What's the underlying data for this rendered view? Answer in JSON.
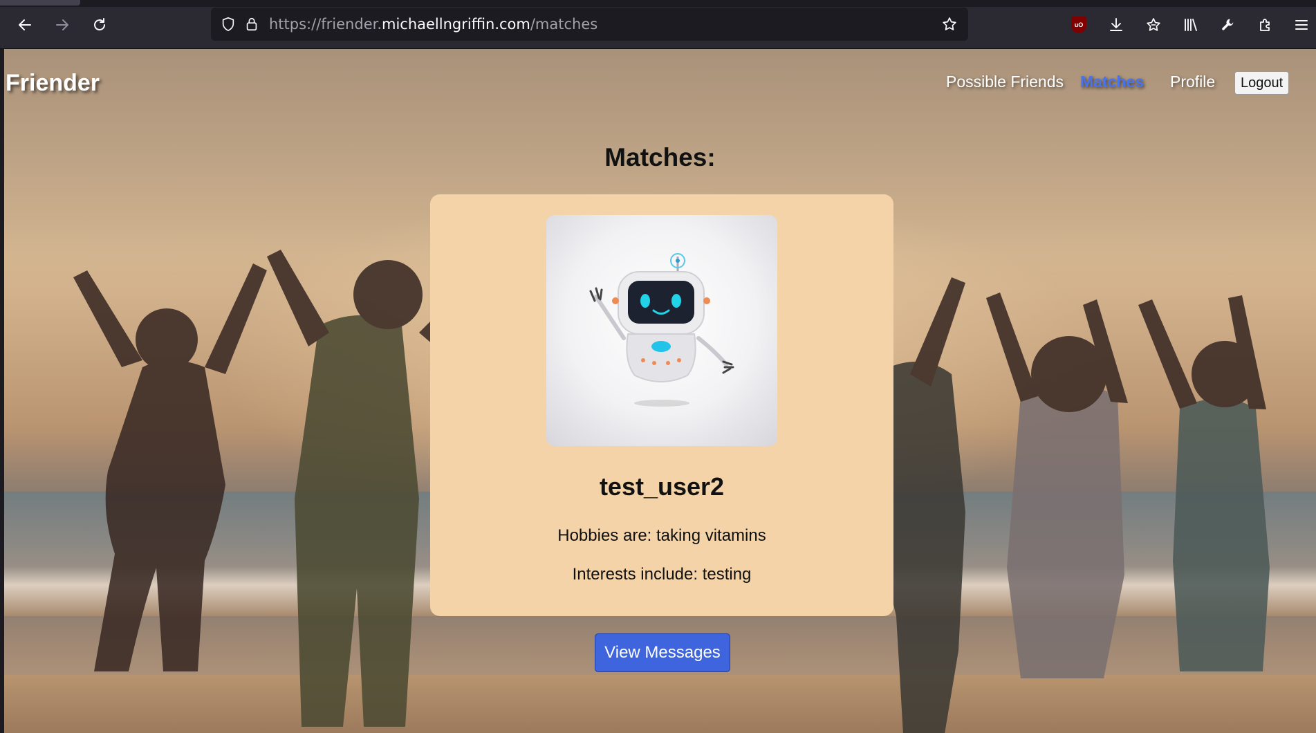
{
  "browser": {
    "url_prefix": "https://friender.",
    "url_domain": "michaellngriffin.com",
    "url_path": "/matches",
    "ublock_badge": "uO"
  },
  "nav": {
    "brand": "Friender",
    "links": [
      "Possible Friends",
      "Matches",
      "Profile"
    ],
    "active_link": "Matches",
    "logout": "Logout"
  },
  "page": {
    "heading": "Matches:",
    "match": {
      "username": "test_user2",
      "hobbies": "Hobbies are: taking vitamins",
      "interests": "Interests include: testing"
    },
    "view_messages": "View Messages"
  },
  "colors": {
    "card": "#f3d3a7",
    "accent": "#3e64de",
    "active_link": "#4a73e8"
  }
}
